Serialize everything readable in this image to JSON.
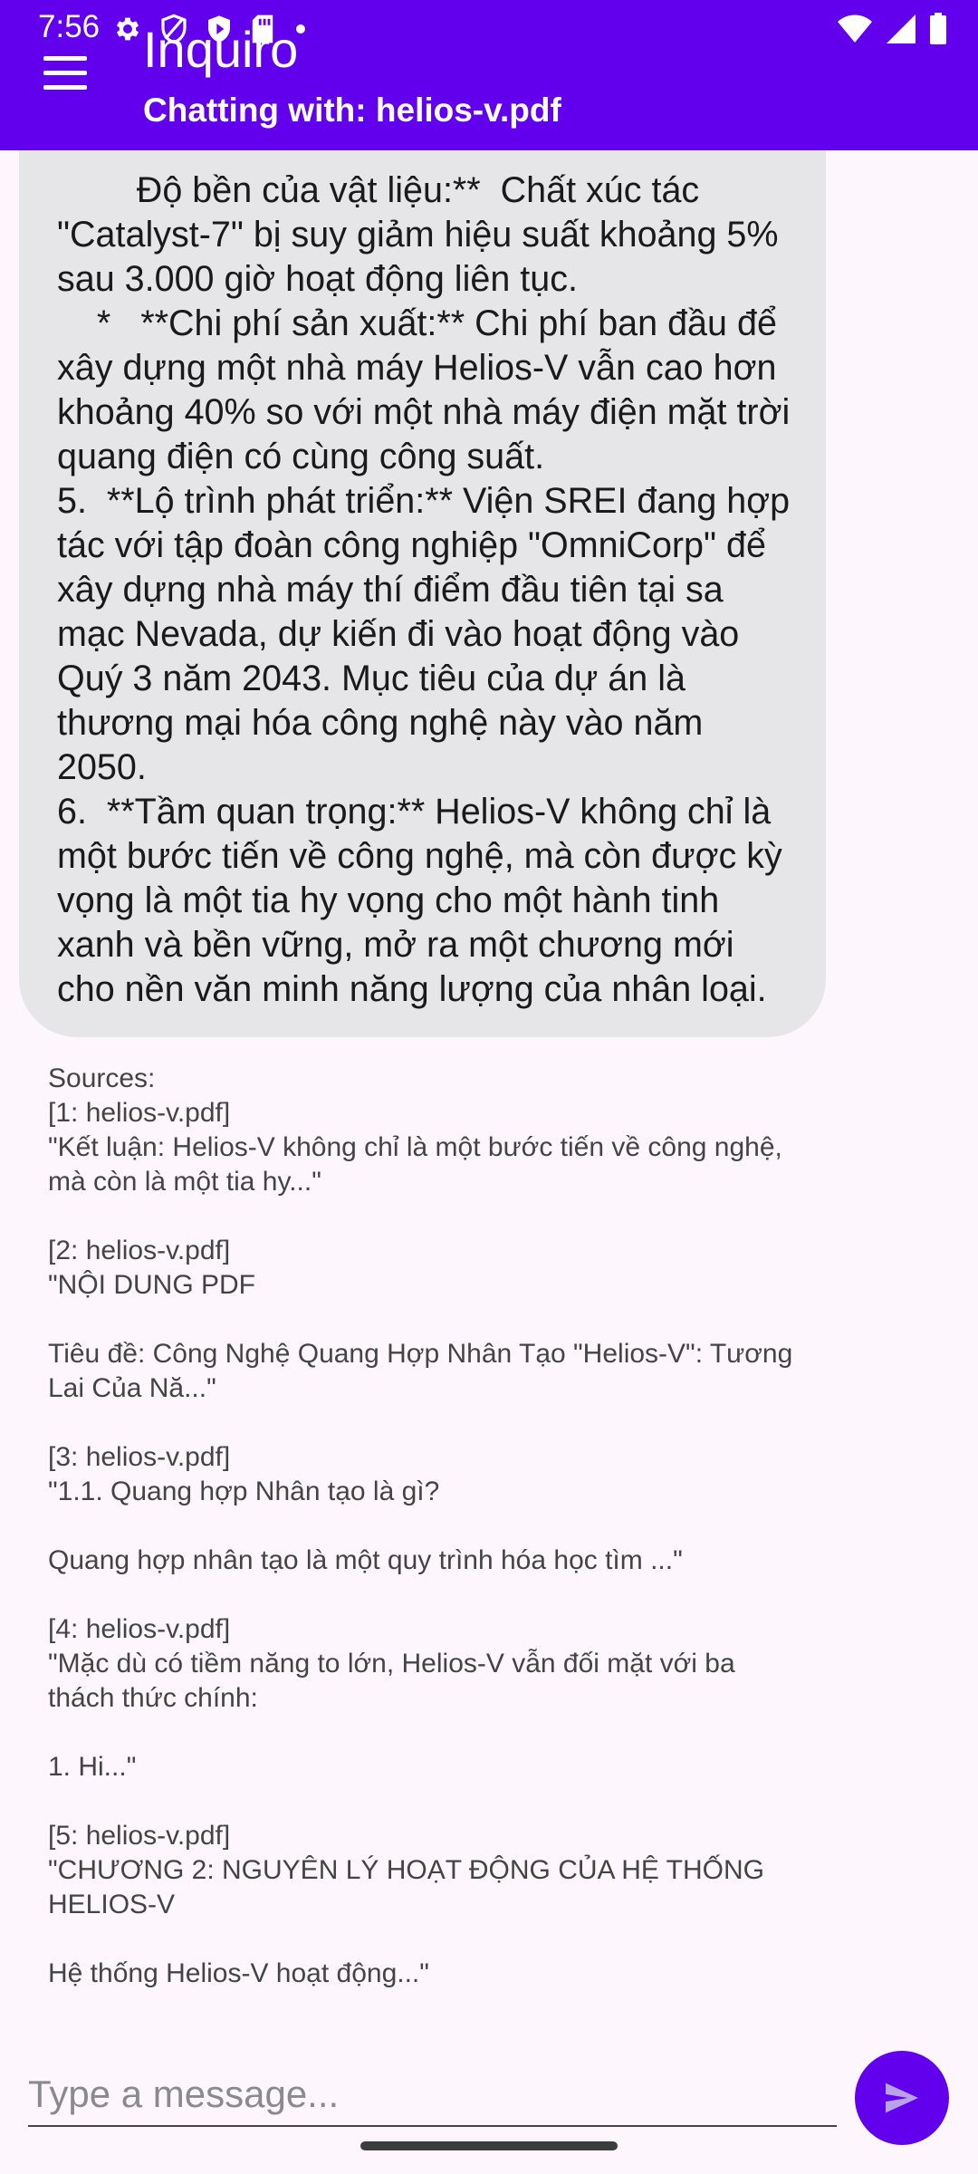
{
  "status_bar": {
    "time": "7:56",
    "icons": [
      "gear-icon",
      "shield-outline-icon",
      "shield-play-icon",
      "sd-card-icon",
      "dot-icon",
      "wifi-icon",
      "cellular-signal-icon",
      "battery-icon"
    ]
  },
  "app_bar": {
    "title": "Inquiro",
    "subtitle": "Chatting with: helios-v.pdf",
    "menu_icon": "hamburger-menu-icon",
    "background_color": "#6200ee"
  },
  "chat": {
    "assistant_message": "        Độ bền của vật liệu:**  Chất xúc tác \"Catalyst-7\" bị suy giảm hiệu suất khoảng 5% sau 3.000 giờ hoạt động liên tục.\n    *   **Chi phí sản xuất:** Chi phí ban đầu để xây dựng một nhà máy Helios-V vẫn cao hơn khoảng 40% so với một nhà máy điện mặt trời quang điện có cùng công suất.\n5.  **Lộ trình phát triển:** Viện SREI đang hợp tác với tập đoàn công nghiệp \"OmniCorp\" để xây dựng nhà máy thí điểm đầu tiên tại sa mạc Nevada, dự kiến đi vào hoạt động vào Quý 3 năm 2043. Mục tiêu của dự án là thương mại hóa công nghệ này vào năm 2050.\n6.  **Tầm quan trọng:** Helios-V không chỉ là một bước tiến về công nghệ, mà còn được kỳ vọng là một tia hy vọng cho một hành tinh xanh và bền vững, mở ra một chương mới cho nền văn minh năng lượng của nhân loại.",
    "bubble_color": "#e6e6e9",
    "sources": "Sources:\n[1: helios-v.pdf]\n\"Kết luận: Helios-V không chỉ là một bước tiến về công nghệ, mà còn là một tia hy...\"\n\n[2: helios-v.pdf]\n\"NỘI DUNG PDF\n\nTiêu đề: Công Nghệ Quang Hợp Nhân Tạo \"Helios-V\": Tương Lai Của Nă...\"\n\n[3: helios-v.pdf]\n\"1.1. Quang hợp Nhân tạo là gì?\n\nQuang hợp nhân tạo là một quy trình hóa học tìm ...\"\n\n[4: helios-v.pdf]\n\"Mặc dù có tiềm năng to lớn, Helios-V vẫn đối mặt với ba thách thức chính:\n\n1. Hi...\"\n\n[5: helios-v.pdf]\n\"CHƯƠNG 2: NGUYÊN LÝ HOẠT ĐỘNG CỦA HỆ THỐNG HELIOS-V\n\nHệ thống Helios-V hoạt động...\""
  },
  "composer": {
    "placeholder": "Type a message...",
    "value": "",
    "send_icon": "send-icon",
    "accent_color": "#6200ee"
  }
}
